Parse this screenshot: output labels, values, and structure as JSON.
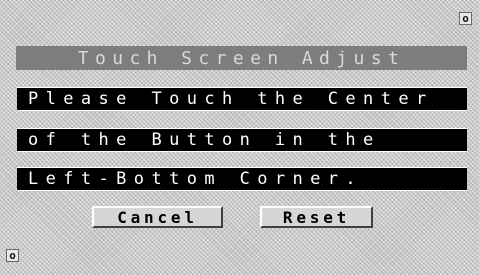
{
  "title": "Touch Screen Adjust",
  "markers": {
    "top_right": "o",
    "bottom_left": "o"
  },
  "message": {
    "lines": [
      "Please Touch the Center",
      "of the Button in the",
      "Left-Bottom Corner."
    ]
  },
  "buttons": {
    "cancel_label": "Cancel",
    "reset_label": "Reset"
  }
}
